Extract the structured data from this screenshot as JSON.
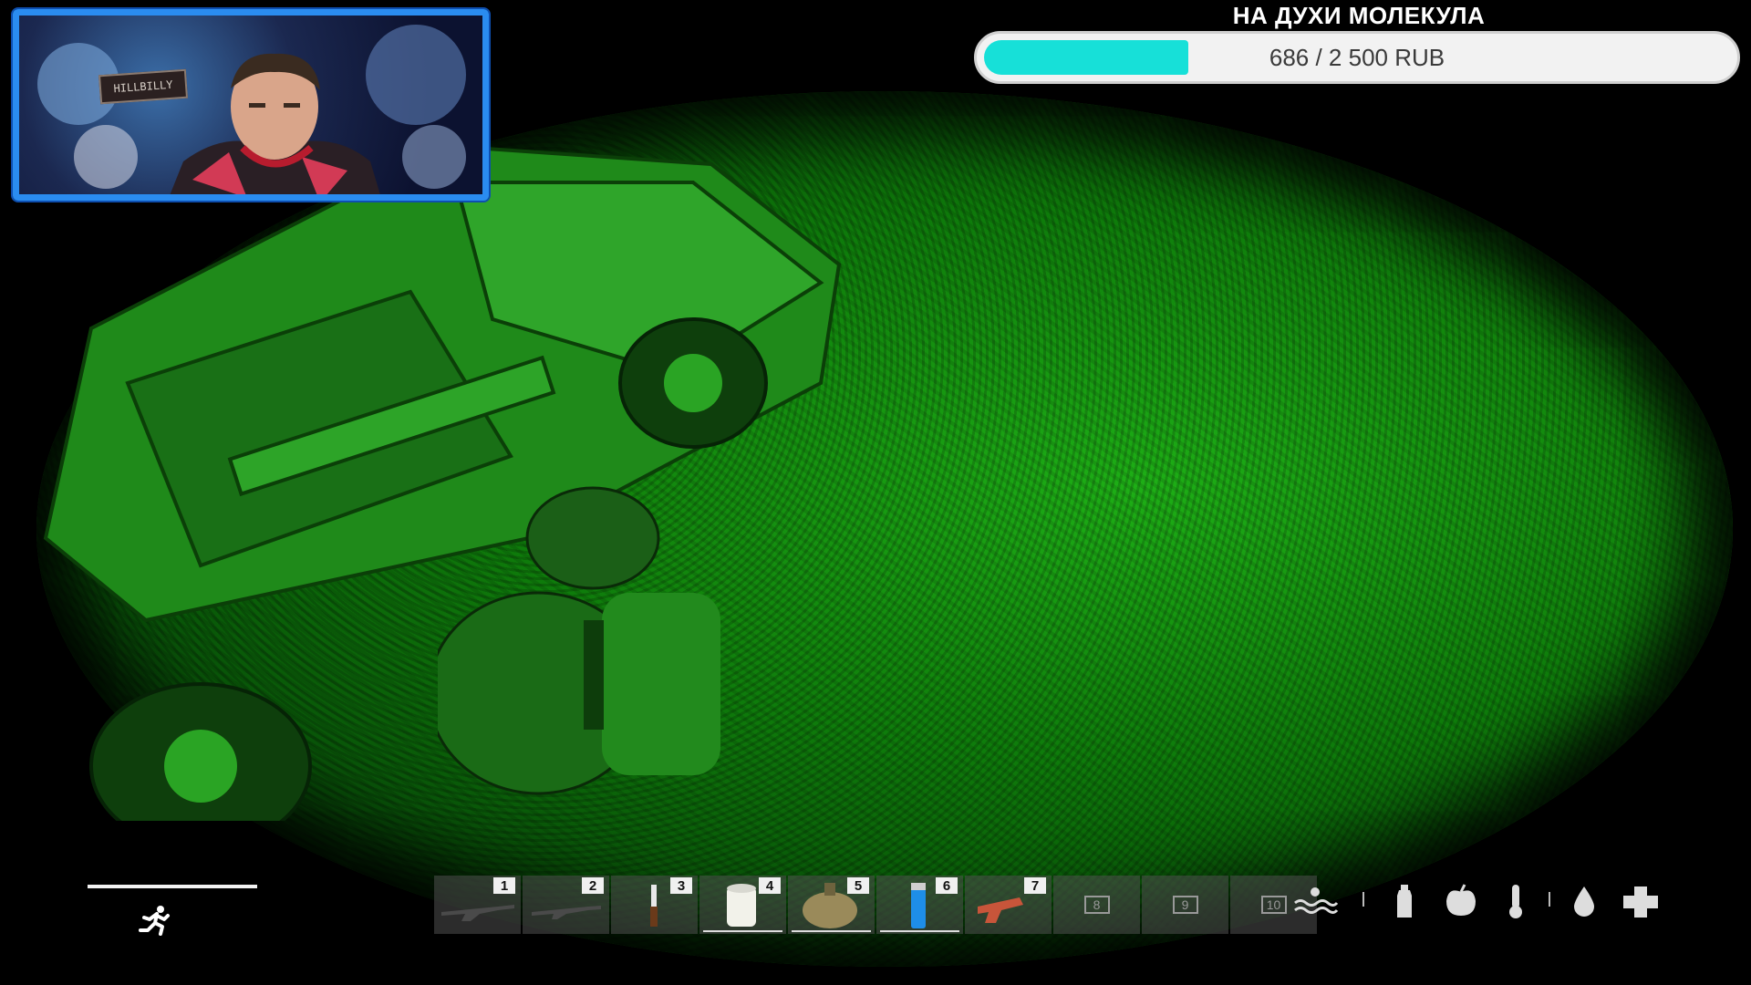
{
  "donation": {
    "title": "НА ДУХИ МОЛЕКУЛА",
    "amount_text": "686 / 2 500 RUB",
    "progress": 0.2744,
    "fill_color": "#17e0d8"
  },
  "webcam": {
    "logo_text": "HILLBILLY"
  },
  "hud": {
    "stamina_icon": "running-person-icon",
    "hotbar": [
      {
        "number": "1",
        "item": "rifle-icon",
        "filled": true
      },
      {
        "number": "2",
        "item": "rifle-icon",
        "filled": true
      },
      {
        "number": "3",
        "item": "knife-icon",
        "filled": true
      },
      {
        "number": "4",
        "item": "canned-food-icon",
        "filled": true
      },
      {
        "number": "5",
        "item": "canteen-icon",
        "filled": true
      },
      {
        "number": "6",
        "item": "lighter-icon",
        "filled": true
      },
      {
        "number": "7",
        "item": "flare-gun-icon",
        "filled": true
      },
      {
        "number": "8",
        "item": "",
        "filled": false
      },
      {
        "number": "9",
        "item": "",
        "filled": false
      },
      {
        "number": "10",
        "item": "",
        "filled": false
      }
    ],
    "status_icons": [
      "water-level-icon",
      "bottle-icon",
      "apple-icon",
      "thermometer-icon",
      "blood-drop-icon",
      "health-cross-icon"
    ]
  },
  "colors": {
    "night_vision": "#22c81a",
    "webcam_frame": "#2a8cf0"
  }
}
